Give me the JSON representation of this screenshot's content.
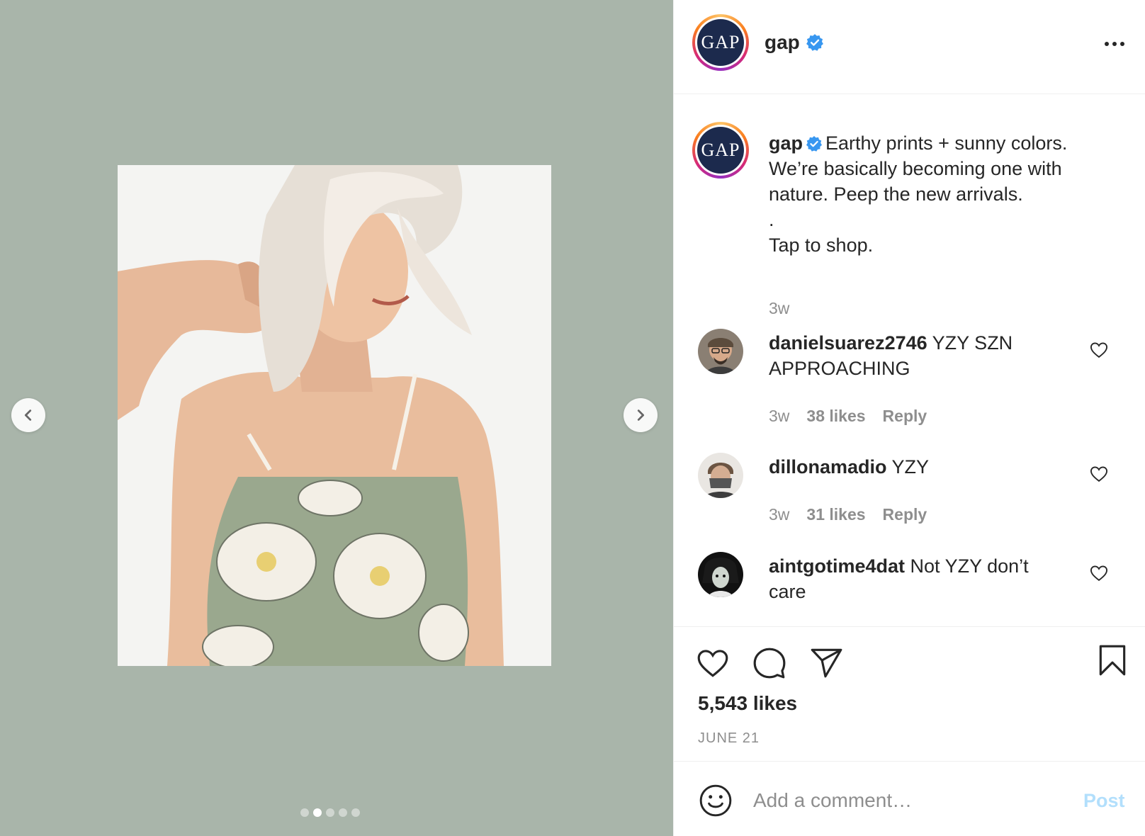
{
  "post": {
    "username": "gap",
    "logo_text": "GAP",
    "verified": true,
    "carousel": {
      "total_slides": 5,
      "active_slide": 2
    },
    "caption": {
      "line1": "Earthy prints + sunny colors. We’re basically becoming one with nature. Peep the new arrivals.",
      "line2": ".",
      "line3": "Tap to shop.",
      "time": "3w"
    },
    "comments": [
      {
        "username": "danielsuarez2746",
        "text": "YZY SZN APPROACHING",
        "time": "3w",
        "likes": "38 likes",
        "reply": "Reply"
      },
      {
        "username": "dillonamadio",
        "text": "YZY",
        "time": "3w",
        "likes": "31 likes",
        "reply": "Reply"
      },
      {
        "username": "aintgotime4dat",
        "text": "Not YZY don’t care"
      }
    ],
    "likes": "5,543 likes",
    "date": "JUNE 21"
  },
  "add_comment": {
    "placeholder": "Add a comment…",
    "post_label": "Post"
  },
  "icons": {
    "more": "more-options-icon",
    "like": "heart-icon",
    "comment": "comment-bubble-icon",
    "share": "paper-plane-icon",
    "save": "bookmark-icon",
    "emoji": "emoji-icon",
    "verified": "verified-badge-icon"
  },
  "colors": {
    "media_bg": "#a9b5aa",
    "verified": "#3897f0",
    "post_disabled": "#b2dffc",
    "gap_navy": "#1c2a4d"
  }
}
